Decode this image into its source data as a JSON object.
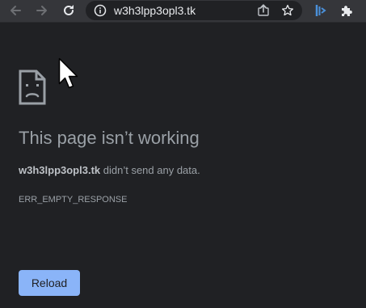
{
  "browser": {
    "url": "w3h3lpp3opl3.tk",
    "icons": {
      "back": "arrow-left-icon",
      "forward": "arrow-right-icon",
      "reload": "reload-icon",
      "site_info": "info-icon",
      "share": "share-icon",
      "bookmark": "star-icon",
      "extension_1": "bitwarden-icon",
      "extensions": "puzzle-icon"
    }
  },
  "error_page": {
    "icon": "sad-page-icon",
    "title": "This page isn’t working",
    "host": "w3h3lpp3opl3.tk",
    "description": " didn’t send any data.",
    "error_code": "ERR_EMPTY_RESPONSE",
    "reload_label": "Reload"
  },
  "colors": {
    "background": "#202124",
    "toolbar": "#35363a",
    "text_muted": "#9aa0a6",
    "accent": "#8ab4f8"
  }
}
